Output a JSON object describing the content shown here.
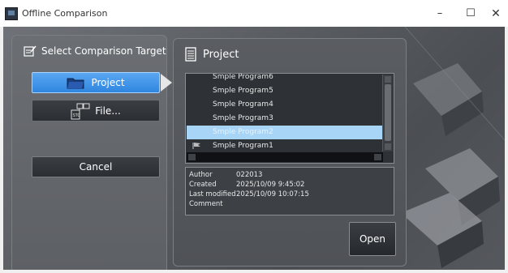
{
  "window": {
    "title": "Offline Comparison",
    "controls": {
      "minimize": "–",
      "maximize": "☐",
      "close": "✕"
    }
  },
  "left_panel": {
    "header": "Select Comparison Target",
    "project_button": "Project",
    "file_button": "File...",
    "cancel_button": "Cancel"
  },
  "project_panel": {
    "header": "Project",
    "items": [
      {
        "label": "Smple Program6",
        "selected": false,
        "icon": ""
      },
      {
        "label": "Smple Program5",
        "selected": false,
        "icon": ""
      },
      {
        "label": "Smple Program4",
        "selected": false,
        "icon": ""
      },
      {
        "label": "Smple Program3",
        "selected": false,
        "icon": ""
      },
      {
        "label": "Smple Program2",
        "selected": true,
        "icon": ""
      },
      {
        "label": "Smple Program1",
        "selected": false,
        "icon": "project-flag-icon"
      }
    ],
    "info": {
      "author_label": "Author",
      "author_value": "022013",
      "created_label": "Created",
      "created_value": "2025/10/09 9:45:02",
      "modified_label": "Last modified",
      "modified_value": "2025/10/09 10:07:15",
      "comment_label": "Comment",
      "comment_value": ""
    },
    "open_button": "Open"
  },
  "colors": {
    "selected_button": "#3b8fe6",
    "selected_row": "#a8d4f5",
    "panel": "#55585d"
  }
}
